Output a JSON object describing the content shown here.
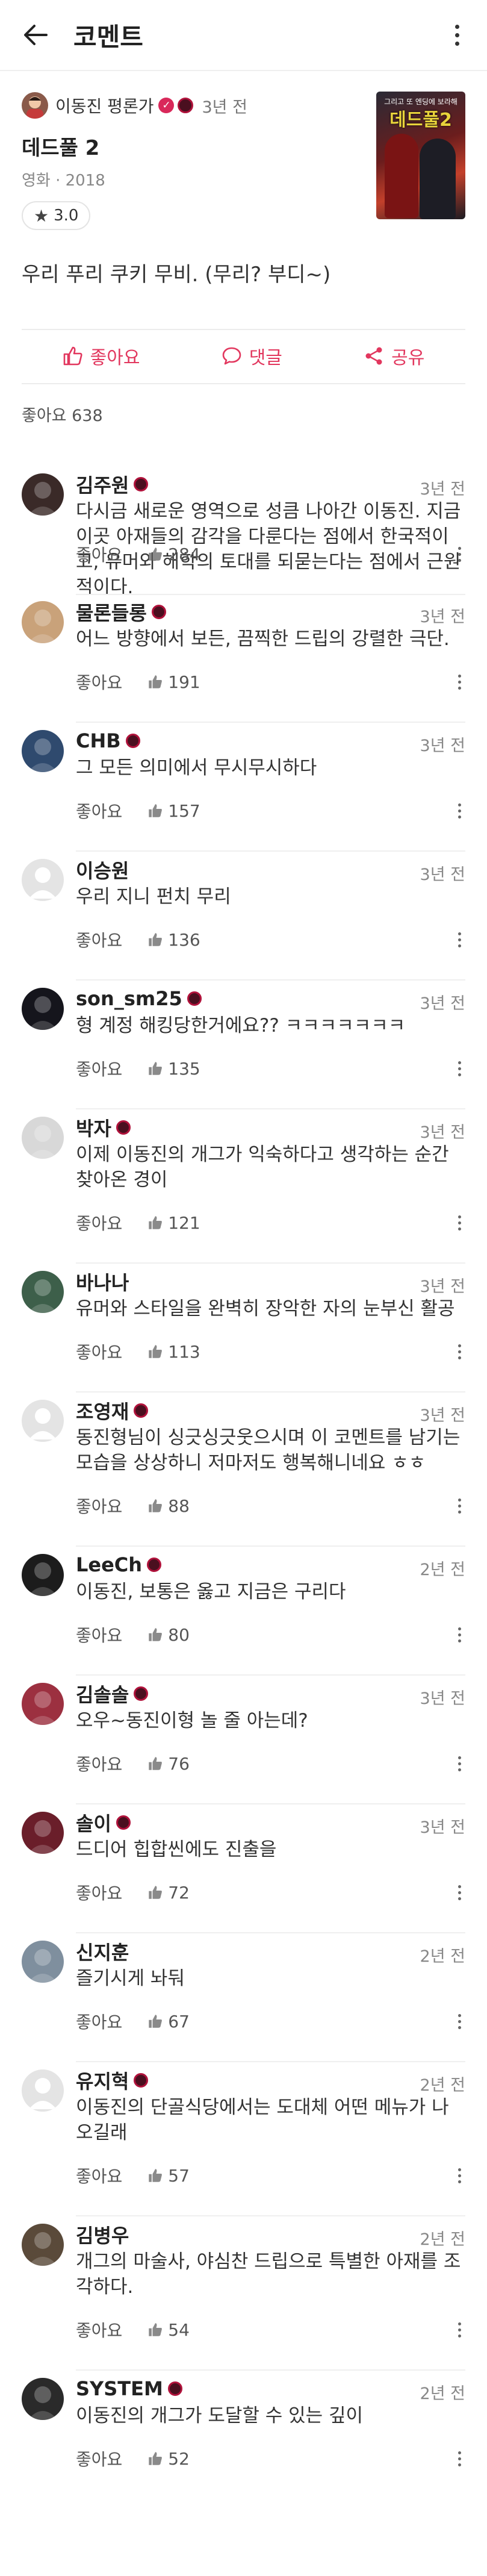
{
  "appbar": {
    "title": "코멘트",
    "back_icon": "arrow-left-icon",
    "more_icon": "more-vertical-icon"
  },
  "header": {
    "author": "이동진 평론가",
    "time": "3년 전",
    "movie_title": "데드풀 2",
    "movie_meta": "영화 · 2018",
    "rating": "3.0",
    "poster": {
      "top_text": "그리고 또 엔딩에 보라해",
      "title": "데드풀2"
    }
  },
  "comment": {
    "text": "우리 푸리 쿠키 무비. (무리? 부디~)"
  },
  "actions": {
    "like_label": "좋아요",
    "reply_label": "댓글",
    "share_label": "공유"
  },
  "likes_summary": {
    "label": "좋아요",
    "count": "638"
  },
  "colors": {
    "accent": "#e2375e",
    "badge": "#b0123b"
  },
  "replies": [
    {
      "name": "김주원",
      "badge": true,
      "time": "3년 전",
      "text": "다시금 새로운 영역으로 성큼 나아간 이동진. 지금 이곳 아재들의 감각을 다룬다는 점에서 한국적이고, 유머와 해학의 토대를 되묻는다는 점에서 근원적이다.",
      "like_label": "좋아요",
      "likes": "284",
      "avatar": "#3a2a28"
    },
    {
      "name": "물론들롱",
      "badge": true,
      "time": "3년 전",
      "text": "어느 방향에서 보든, 끔찍한 드립의 강렬한 극단.",
      "like_label": "좋아요",
      "likes": "191",
      "avatar": "#c9a27a"
    },
    {
      "name": "CHB",
      "badge": true,
      "time": "3년 전",
      "text": "그 모든 의미에서 무시무시하다",
      "like_label": "좋아요",
      "likes": "157",
      "avatar": "#2f4a6e"
    },
    {
      "name": "이승원",
      "badge": false,
      "time": "3년 전",
      "text": "우리 지니 펀치 무리",
      "like_label": "좋아요",
      "likes": "136",
      "avatar": "default"
    },
    {
      "name": "son_sm25",
      "badge": true,
      "time": "3년 전",
      "text": "형 계정 해킹당한거에요?? ㅋㅋㅋㅋㅋㅋㅋ",
      "like_label": "좋아요",
      "likes": "135",
      "avatar": "#15151c"
    },
    {
      "name": "박자",
      "badge": true,
      "time": "3년 전",
      "text": "이제 이동진의 개그가 익숙하다고 생각하는 순간 찾아온 경이",
      "like_label": "좋아요",
      "likes": "121",
      "avatar": "#d8d8d8"
    },
    {
      "name": "바나나",
      "badge": false,
      "time": "3년 전",
      "text": "유머와 스타일을 완벽히 장악한 자의 눈부신 활공",
      "like_label": "좋아요",
      "likes": "113",
      "avatar": "#3d5f4a"
    },
    {
      "name": "조영재",
      "badge": true,
      "time": "3년 전",
      "text": "동진형님이 싱긋싱긋웃으시며 이 코멘트를 남기는 모습을 상상하니 저마저도 행복해니네요 ㅎㅎ",
      "like_label": "좋아요",
      "likes": "88",
      "avatar": "default"
    },
    {
      "name": "LeeCh",
      "badge": true,
      "time": "2년 전",
      "text": "이동진, 보통은 옳고 지금은 구리다",
      "like_label": "좋아요",
      "likes": "80",
      "avatar": "#1c1c1c"
    },
    {
      "name": "김솔솔",
      "badge": true,
      "time": "3년 전",
      "text": "오우~동진이형 놀 줄 아는데?",
      "like_label": "좋아요",
      "likes": "76",
      "avatar": "#9c3040"
    },
    {
      "name": "솔이",
      "badge": true,
      "time": "3년 전",
      "text": "드디어 힙합씬에도 진출을",
      "like_label": "좋아요",
      "likes": "72",
      "avatar": "#6a1e2a"
    },
    {
      "name": "신지훈",
      "badge": false,
      "time": "2년 전",
      "text": "즐기시게 놔둬",
      "like_label": "좋아요",
      "likes": "67",
      "avatar": "#7f8f9e"
    },
    {
      "name": "유지혁",
      "badge": true,
      "time": "2년 전",
      "text": "이동진의 단골식당에서는 도대체 어떤 메뉴가 나오길래",
      "like_label": "좋아요",
      "likes": "57",
      "avatar": "default"
    },
    {
      "name": "김병우",
      "badge": false,
      "time": "2년 전",
      "text": "개그의 마술사, 야심찬 드립으로 특별한 아재를 조각하다.",
      "like_label": "좋아요",
      "likes": "54",
      "avatar": "#5a4a3a"
    },
    {
      "name": "SYSTEM",
      "badge": true,
      "time": "2년 전",
      "text": "이동진의 개그가 도달할 수 있는 깊이",
      "like_label": "좋아요",
      "likes": "52",
      "avatar": "#2a2a2a"
    }
  ]
}
